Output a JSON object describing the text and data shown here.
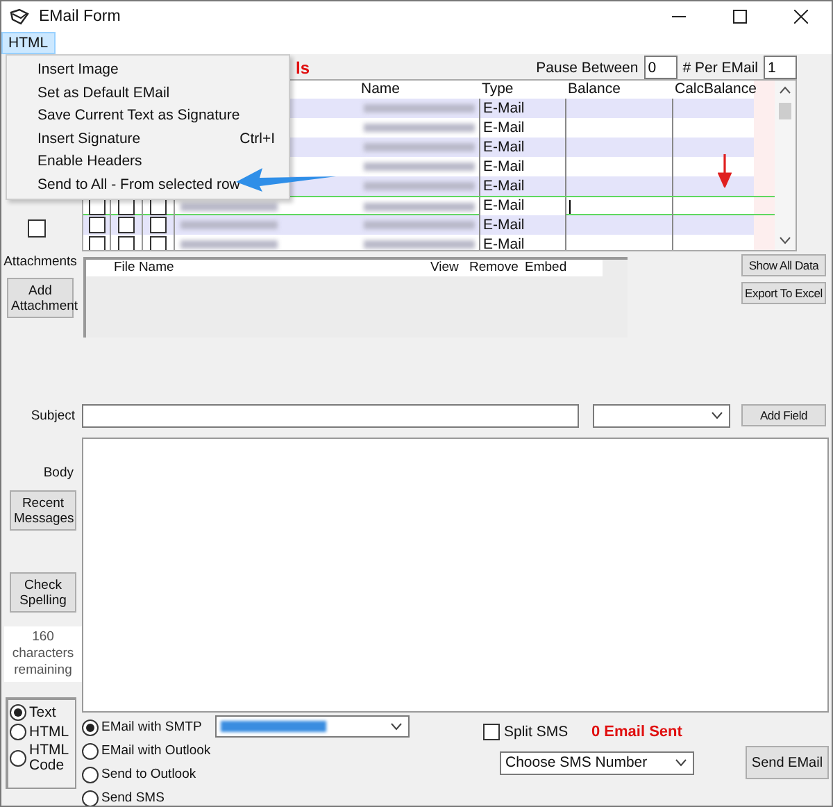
{
  "window": {
    "title": "EMail Form"
  },
  "menu_bar": [
    {
      "label": "HTML",
      "selected": true
    }
  ],
  "menu": {
    "items": [
      {
        "label": "Insert Image"
      },
      {
        "label": "Set as Default EMail"
      },
      {
        "label": "Save Current Text as Signature"
      },
      {
        "label": "Insert Signature",
        "shortcut": "Ctrl+I"
      },
      {
        "label": "Enable Headers"
      },
      {
        "label": "Send to All - From selected row"
      }
    ]
  },
  "recipients": {
    "heading_fragment": "ls",
    "pause_between": {
      "label": "Pause Between",
      "value": "0"
    },
    "per_email": {
      "label": "# Per EMail",
      "value": "1"
    },
    "select_all_checked": false,
    "columns": [
      "Name",
      "Type",
      "Balance",
      "CalcBalance"
    ],
    "rows": [
      {
        "type": "E-Mail",
        "selected": false
      },
      {
        "type": "E-Mail",
        "selected": false
      },
      {
        "type": "E-Mail",
        "selected": false
      },
      {
        "type": "E-Mail",
        "selected": false
      },
      {
        "type": "E-Mail",
        "selected": false
      },
      {
        "type": "E-Mail",
        "selected": true,
        "checks": [
          false,
          false,
          false
        ]
      },
      {
        "type": "E-Mail",
        "selected": false,
        "checks": [
          false,
          false,
          false
        ]
      },
      {
        "type": "E-Mail",
        "selected": false,
        "checks": [
          false,
          false,
          false
        ]
      }
    ]
  },
  "attachments": {
    "label": "Attachments",
    "add_button": "Add Attachment",
    "columns": [
      "File Name",
      "View",
      "Remove",
      "Embed"
    ]
  },
  "side_buttons": [
    "Show All Data",
    "Export To Excel"
  ],
  "subject": {
    "label": "Subject",
    "add_field_button": "Add Field"
  },
  "body": {
    "label": "Body",
    "recent_button": "Recent Messages",
    "spell_button": "Check Spelling",
    "counter": "160 characters remaining"
  },
  "format_options": [
    {
      "label": "Text",
      "selected": true
    },
    {
      "label": "HTML",
      "selected": false
    },
    {
      "label": "HTML Code",
      "selected": false
    }
  ],
  "send_methods": [
    {
      "label": "EMail with SMTP",
      "selected": true
    },
    {
      "label": "EMail with Outlook",
      "selected": false
    },
    {
      "label": "Send to Outlook",
      "selected": false
    },
    {
      "label": "Send SMS",
      "selected": false
    }
  ],
  "split_sms": {
    "label": "Split SMS",
    "checked": false
  },
  "sent_status": "0 Email Sent",
  "sms_number": {
    "value": "Choose SMS Number"
  },
  "send_button": "Send EMail"
}
